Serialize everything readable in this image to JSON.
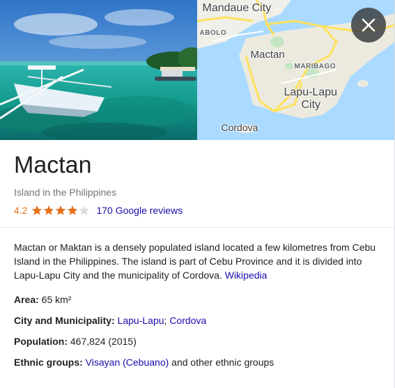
{
  "media": {
    "photo_credit": "",
    "map_labels": {
      "mandaue": "Mandaue City",
      "abolo": "ABOLO",
      "mactan": "Mactan",
      "maribago": "MARIBAGO",
      "lapu1": "Lapu-Lapu",
      "lapu2": "City",
      "cordova": "Cordova"
    }
  },
  "header": {
    "title": "Mactan",
    "subtitle": "Island in the Philippines",
    "rating": "4.2",
    "stars_filled": 4,
    "reviews_label": "170 Google reviews"
  },
  "description": {
    "text": "Mactan or Maktan is a densely populated island located a few kilometres from Cebu Island in the Philippines. The island is part of Cebu Province and it is divided into Lapu-Lapu City and the municipality of Cordova. ",
    "source_link": "Wikipedia"
  },
  "facts": {
    "area_label": "Area:",
    "area_value": " 65 km²",
    "city_label": "City and Municipality:",
    "city_link1": "Lapu-Lapu",
    "city_sep": "; ",
    "city_link2": "Cordova",
    "population_label": "Population:",
    "population_value": " 467,824 (2015)",
    "ethnic_label": "Ethnic groups:",
    "ethnic_link": "Visayan (Cebuano)",
    "ethnic_rest": " and other ethnic groups"
  },
  "colors": {
    "link": "#1a0dab",
    "rating": "#e7711b",
    "star_filled": "#e7711b",
    "star_empty": "#dadce0"
  }
}
